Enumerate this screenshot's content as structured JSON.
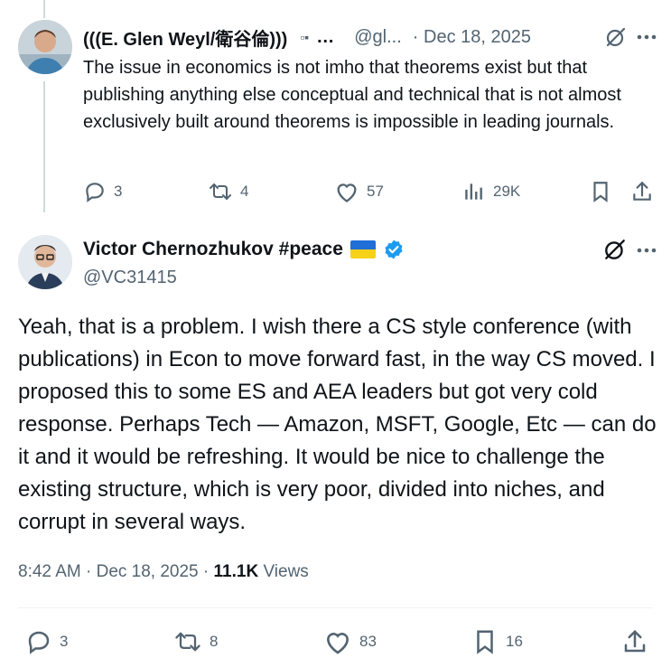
{
  "reply": {
    "name": "(((E. Glen Weyl/衛谷倫)))",
    "name_suffix": "…",
    "handle": "@gl...",
    "date": "· Dec 18, 2025",
    "text": "The issue in economics is not imho that theorems exist but that publishing anything else conceptual and technical that is not almost exclusively built around theorems is impossible in leading journals.",
    "replies": "3",
    "reposts": "4",
    "likes": "57",
    "views": "29K"
  },
  "post": {
    "name": "Victor Chernozhukov #peace",
    "handle": "@VC31415",
    "text": "Yeah, that is a problem. I wish there a CS style conference (with publications) in Econ to move forward fast, in the way CS moved. I proposed this to some ES and AEA leaders but got very cold response. Perhaps Tech — Amazon, MSFT, Google, Etc — can do it and it would be refreshing. It would be nice to challenge the existing structure, which is very poor, divided into niches, and corrupt in several ways.",
    "time": "8:42 AM · Dec 18, 2025 · ",
    "views_count": "11.1K",
    "views_label": " Views",
    "replies": "3",
    "reposts": "8",
    "likes": "83",
    "bookmarks": "16"
  },
  "colors": {
    "text": "#0f1419",
    "muted": "#536471",
    "verified": "#1d9bf0",
    "flag_blue": "#1f6fd6",
    "flag_yellow": "#f7d117"
  },
  "icons": {
    "reply": "reply-icon",
    "repost": "repost-icon",
    "like": "heart-icon",
    "views": "views-icon",
    "bookmark": "bookmark-icon",
    "share": "share-icon",
    "grok": "grok-icon",
    "more": "more-icon",
    "verified": "verified-badge-icon"
  }
}
